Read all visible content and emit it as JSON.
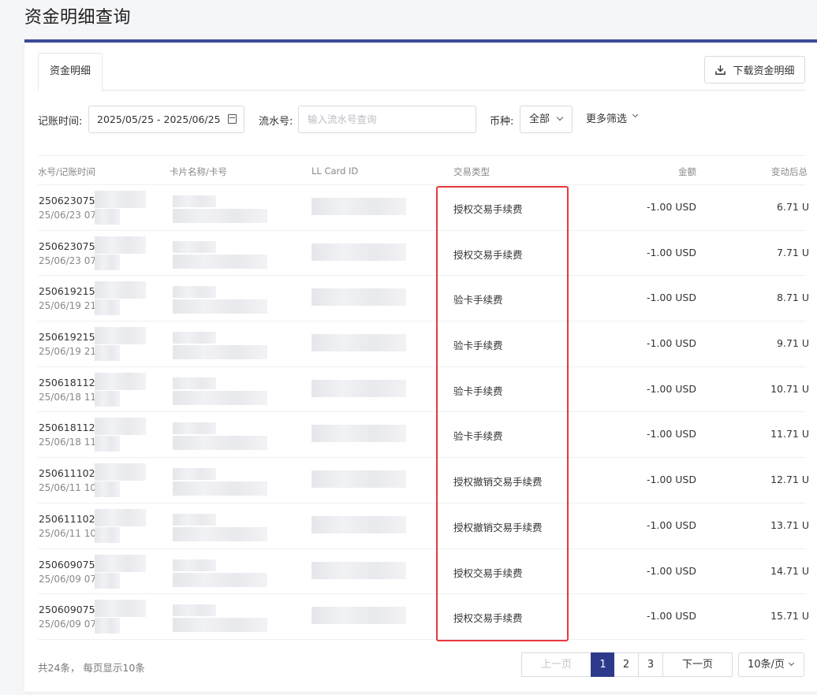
{
  "page_title": "资金明细查询",
  "tab": "资金明细",
  "download_label": "下载资金明细",
  "filters": {
    "date_label": "记账时间:",
    "date_range": "2025/05/25 - 2025/06/25",
    "serial_label": "流水号:",
    "serial_placeholder": "输入流水号查询",
    "currency_label": "币种:",
    "currency_value": "全部",
    "more_filter": "更多筛选"
  },
  "columns": [
    "水号/记账时间",
    "卡片名称/卡号",
    "LL Card ID",
    "交易类型",
    "金额",
    "变动后总"
  ],
  "rows": [
    {
      "serial": "2506230755",
      "time": "25/06/23 07:",
      "type": "授权交易手续费",
      "amount": "-1.00 USD",
      "balance": "6.71 U"
    },
    {
      "serial": "2506230755",
      "time": "25/06/23 07:",
      "type": "授权交易手续费",
      "amount": "-1.00 USD",
      "balance": "7.71 U"
    },
    {
      "serial": "2506192155",
      "time": "25/06/19 21:",
      "type": "验卡手续费",
      "amount": "-1.00 USD",
      "balance": "8.71 U"
    },
    {
      "serial": "2506192155",
      "time": "25/06/19 21:",
      "type": "验卡手续费",
      "amount": "-1.00 USD",
      "balance": "9.71 U"
    },
    {
      "serial": "2506181126",
      "time": "25/06/18 11:",
      "type": "验卡手续费",
      "amount": "-1.00 USD",
      "balance": "10.71 U"
    },
    {
      "serial": "2506181126",
      "time": "25/06/18 11:",
      "type": "验卡手续费",
      "amount": "-1.00 USD",
      "balance": "11.71 U"
    },
    {
      "serial": "25061110200",
      "time": "25/06/11 10:",
      "type": "授权撤销交易手续费",
      "amount": "-1.00 USD",
      "balance": "12.71 U"
    },
    {
      "serial": "25061110200",
      "time": "25/06/11 10:",
      "type": "授权撤销交易手续费",
      "amount": "-1.00 USD",
      "balance": "13.71 U"
    },
    {
      "serial": "2506090755",
      "time": "25/06/09 07:",
      "type": "授权交易手续费",
      "amount": "-1.00 USD",
      "balance": "14.71 U"
    },
    {
      "serial": "2506090755",
      "time": "25/06/09 07:",
      "type": "授权交易手续费",
      "amount": "-1.00 USD",
      "balance": "15.71 U"
    }
  ],
  "footer": {
    "total": "共24条， 每页显示10条",
    "prev": "上一页",
    "pages": [
      "1",
      "2",
      "3"
    ],
    "next": "下一页",
    "page_size": "10条/页"
  },
  "colors": {
    "accent": "#2d3a8c",
    "highlight": "#e8383d"
  }
}
